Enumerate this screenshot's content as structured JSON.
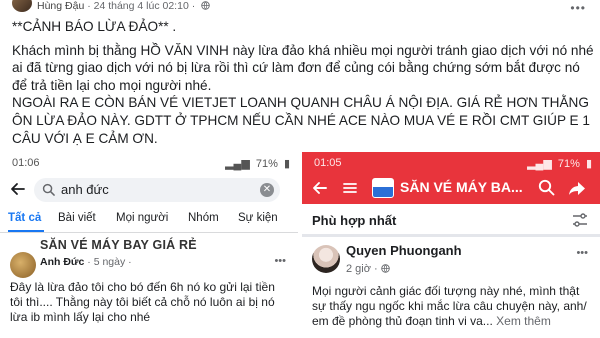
{
  "post": {
    "author": "Hùng Đậu",
    "meta": "· 24 tháng 4 lúc 02:10 ·",
    "paragraphs": [
      "**CẢNH BÁO LỪA ĐẢO** .",
      "Khách mình bị thằng HỒ VĂN VINH này lừa đảo khá nhiều mọi người tránh giao dịch với nó nhé ai đã từng giao dịch với nó bị lừa rồi thì cứ làm đơn để củng cói bằng chứng sớm bắt được nó để trả tiền lại cho mọi người nhé.",
      "NGOÀI RA E CÒN BÁN VÉ VIETJET LOANH QUANH CHÂU Á NỘI ĐỊA. GIÁ RẺ HƠN THẰNG ÔN LỪA ĐẢO NÀY. GDTT Ở TPHCM NẾU CẦN NHÉ ACE NÀO MUA VÉ E RỒI CMT GIÚP E 1 CÂU VỚI Ạ E CẢM ƠN."
    ]
  },
  "shot_left": {
    "status_time": "01:06",
    "status_battery": "71%",
    "search_value": "anh đức",
    "tabs": [
      "Tất cả",
      "Bài viết",
      "Mọi người",
      "Nhóm",
      "Sự kiện"
    ],
    "result": {
      "page_title": "SĂN VÉ MÁY BAY GIÁ RẺ",
      "author": "Anh Đức",
      "time": "· 5 ngày ·",
      "text": "Đây là lừa đảo tôi cho bó đến 6h nó ko gửi lại tiền tôi thì.... Thằng này tôi biết cả chỗ nó luôn ai bị nó lừa ib mình lấy lại cho nhé"
    }
  },
  "shot_right": {
    "status_time": "01:05",
    "status_battery": "71%",
    "page_title": "SĂN VÉ MÁY BA...",
    "filter_label": "Phù hợp nhất",
    "result": {
      "user_name": "Quyen Phuonganh",
      "time": "2 giờ ·",
      "text": "Mọi người cảnh giác đối tượng này nhé, mình thật sự thấy ngu ngốc khi mắc lừa câu chuyện này, anh/ em đề phòng thủ đoạn tinh vi va...",
      "see_more": "Xem thêm"
    }
  },
  "colors": {
    "fb_blue": "#1877f2",
    "header_red": "#e8343c",
    "muted_text": "#65676b"
  },
  "icons": {
    "post_menu": "more-horizontal-icon",
    "globe": "globe-icon",
    "back": "back-arrow-icon",
    "search": "search-icon",
    "clear": "clear-icon",
    "menu": "hamburger-menu-icon",
    "share": "share-icon",
    "filter": "filter-icon"
  }
}
